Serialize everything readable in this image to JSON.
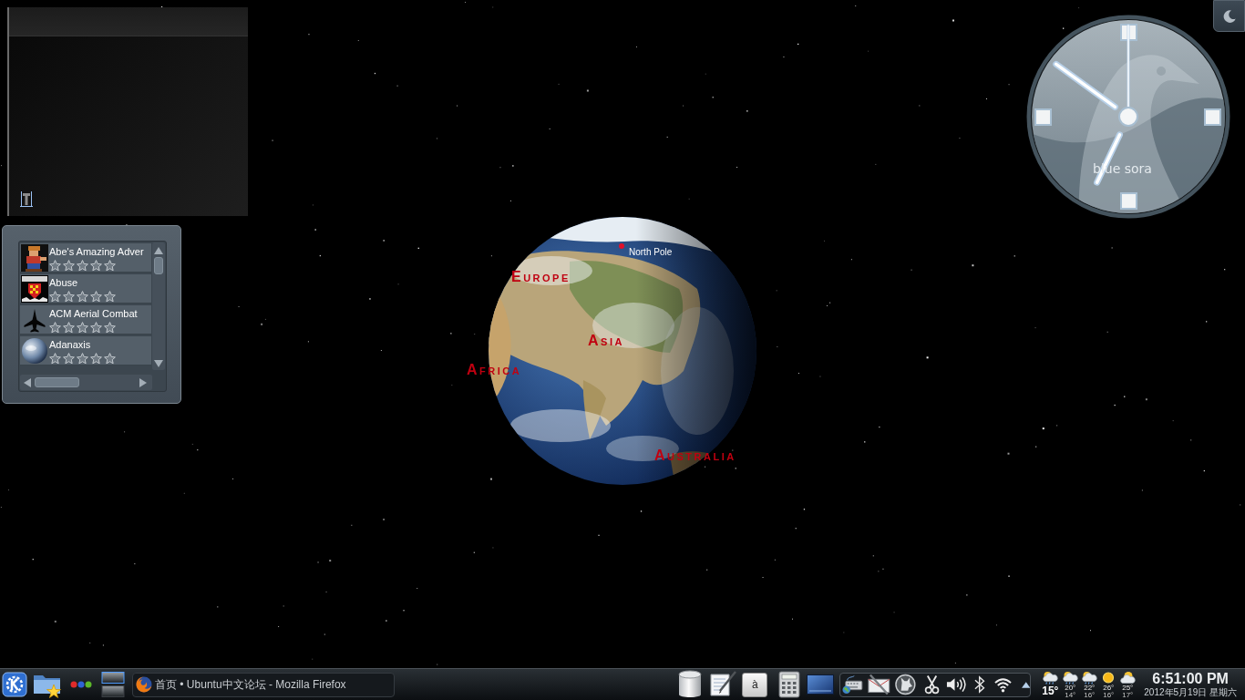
{
  "games_widget": {
    "items": [
      {
        "name": "Abe's Amazing Adver",
        "stars": 0
      },
      {
        "name": "Abuse",
        "stars": 0
      },
      {
        "name": "ACM Aerial Combat",
        "stars": 0
      },
      {
        "name": "Adanaxis",
        "stars": 0
      }
    ]
  },
  "clock_widget": {
    "label": "blue sora"
  },
  "globe": {
    "marker": {
      "label": "North Pole"
    },
    "regions": [
      "EUROPE",
      "ASIA",
      "AFRICA",
      "AUSTRALIA"
    ]
  },
  "taskbar": {
    "tasks": [
      {
        "title": "首页 • Ubuntu中文论坛 - Mozilla Firefox"
      }
    ],
    "key_launcher": "à",
    "weather": {
      "now": {
        "temp": "15°"
      },
      "forecast": [
        {
          "high": "20°",
          "low": "14°"
        },
        {
          "high": "22°",
          "low": "16°"
        },
        {
          "high": "26°",
          "low": "16°"
        },
        {
          "high": "25°",
          "low": "17°"
        }
      ]
    },
    "clock": {
      "time": "6:51:00 PM",
      "date": "2012年5月19日 星期六"
    }
  }
}
